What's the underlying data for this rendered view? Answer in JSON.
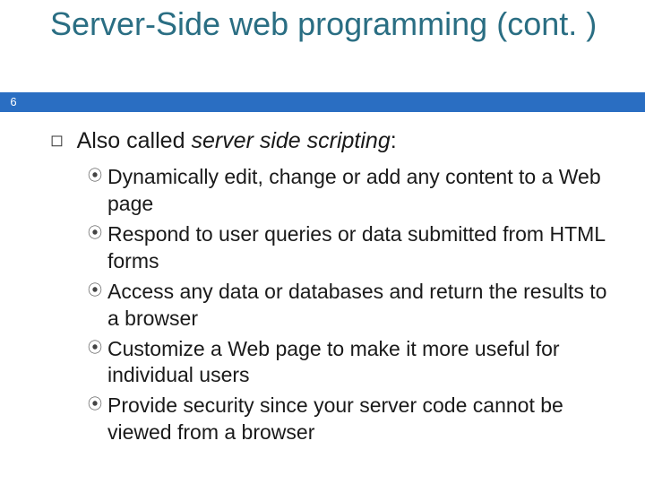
{
  "slide": {
    "page_number": "6",
    "title": "Server-Side web programming (cont. )",
    "body": {
      "lead_prefix": "Also called ",
      "lead_italic": "server side scripting",
      "lead_suffix": ":",
      "items": [
        "Dynamically edit, change or add any content to a Web page",
        "Respond to user queries or data submitted from HTML forms",
        "Access any data or databases and return the results to a browser",
        "Customize a Web page to make it more useful for individual users",
        "Provide security since your server code cannot be viewed from a browser"
      ]
    }
  }
}
